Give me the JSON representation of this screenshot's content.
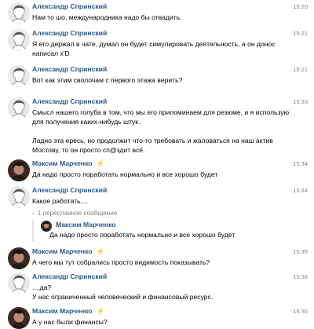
{
  "messages": [
    {
      "author": "Александр Спринский",
      "time": "15:20",
      "lines": [
        "Нам то шо, международника надо бы отвадить."
      ]
    },
    {
      "author": "Александр Спринский",
      "time": "15:21",
      "lines": [
        "Я его держал в чате, думал он будет симулировать деятельность, а он донос",
        "написал х'D"
      ]
    },
    {
      "author": "Александр Спринский",
      "time": "15:21",
      "lines": [
        "Вот как этим сволочам с первого этажа верить?"
      ]
    },
    {
      "author": "Александр Спринский",
      "time": "15:33",
      "lines": [
        "Смысл нашего голуба в том, что мы его припоминаем для резюме, и я использую",
        "для получения каких-нибудь штук.",
        "",
        "Ладно эта ересь, но продолжит что-то требовать и жаловаться на наш актив",
        "Мостову, то он просто сп@здит всё."
      ]
    },
    {
      "author": "Максим Марченко",
      "time": "15:34",
      "lines": [
        "Да надо просто поработать нормально и все хорошо будет"
      ]
    },
    {
      "author": "Александр Спринский",
      "time": "15:34",
      "lines": [
        "Какое работать...."
      ],
      "forward": {
        "label": "1 пересланное сообщение",
        "author": "Максим Марченко",
        "text": "Да надо просто поработать нормально и все хорошо будет"
      }
    },
    {
      "author": "Максим Марченко",
      "time": "15:35",
      "lines": [
        "А чего мы тут собрались просто видимость показывать?"
      ]
    },
    {
      "author": "Александр Спринский",
      "time": "15:36",
      "lines": [
        "....да?",
        "У нас ограниченный человеческий и финансовый ресурс."
      ]
    },
    {
      "author": "Максим Марченко",
      "time": "15:36",
      "lines": [
        "А у нас были финансы?"
      ]
    }
  ],
  "icons": {
    "lightning": "⚡",
    "forward_chevron": "‹"
  },
  "colors": {
    "author": "#2a5885",
    "time": "#828282",
    "lightning": "#e64646"
  }
}
